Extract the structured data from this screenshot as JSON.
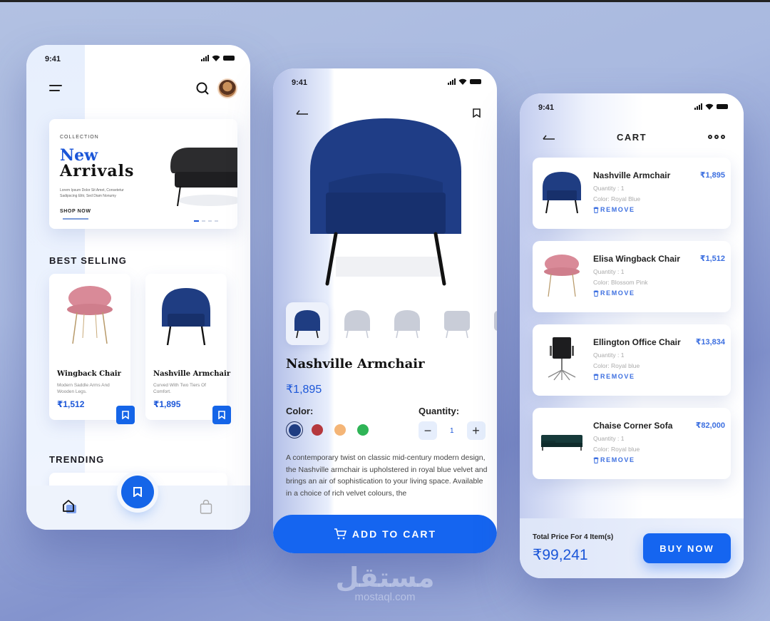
{
  "status_bar": {
    "time": "9:41"
  },
  "home_screen": {
    "banner": {
      "eyebrow": "COLLECTION",
      "title_line1": "New",
      "title_line2": "Arrivals",
      "body": "Lorem Ipsum Dolor Sit Amet, Consetetur Sadipscing Elitr, Sed Diam Nonumy",
      "cta": "SHOP NOW",
      "slide_count": 4,
      "active_slide": 1
    },
    "best_selling_heading": "BEST SELLING",
    "best_selling": [
      {
        "name": "Wingback Chair",
        "desc": "Modern Saddle Arms And Wooden Legs.",
        "price": "₹1,512",
        "color": "#d98a98"
      },
      {
        "name": "Nashville Armchair",
        "desc": "Curved With Two Tiers Of Comfort.",
        "price": "₹1,895",
        "color": "#1f3d82"
      }
    ],
    "trending_heading": "TRENDING",
    "tabbar": {
      "items": [
        "home-icon",
        "bookmark-icon",
        "shopping-bag-icon"
      ],
      "active": "home-icon"
    }
  },
  "product_screen": {
    "name": "Nashville Armchair",
    "price": "₹1,895",
    "color_label": "Color:",
    "colors": [
      {
        "name": "Royal Blue",
        "hex": "#1f3d82",
        "selected": true
      },
      {
        "name": "Red",
        "hex": "#b5383d",
        "selected": false
      },
      {
        "name": "Peach",
        "hex": "#f4b577",
        "selected": false
      },
      {
        "name": "Green",
        "hex": "#2fb456",
        "selected": false
      }
    ],
    "quantity_label": "Quantity:",
    "quantity": "1",
    "minus": "−",
    "plus": "+",
    "description": "A contemporary twist on classic mid-century modern design, the Nashville armchair is upholstered in royal blue velvet and brings an air of sophistication to your living space. Available in a choice of rich velvet colours, the",
    "add_to_cart": "ADD TO CART",
    "thumbnails": 5
  },
  "cart_screen": {
    "title": "CART",
    "items": [
      {
        "name": "Nashville Armchair",
        "quantity": "Quantity : 1",
        "color": "Color: Royal Blue",
        "price": "₹1,895",
        "remove": "REMOVE"
      },
      {
        "name": "Elisa Wingback Chair",
        "quantity": "Quantity : 1",
        "color": "Color: Blossom Pink",
        "price": "₹1,512",
        "remove": "REMOVE"
      },
      {
        "name": "Ellington Office Chair",
        "quantity": "Quantity : 1",
        "color": "Color: Royal blue",
        "price": "₹13,834",
        "remove": "REMOVE"
      },
      {
        "name": "Chaise Corner Sofa",
        "quantity": "Quantity : 1",
        "color": "Color: Royal blue",
        "price": "₹82,000",
        "remove": "REMOVE"
      }
    ],
    "total_label": "Total Price For 4 Item(s)",
    "total": "₹99,241",
    "buy_now": "BUY NOW"
  },
  "watermark": {
    "arabic": "مستقل",
    "latin": "mostaql.com"
  },
  "colors": {
    "accent": "#1565f0",
    "price_blue": "#1b56d8",
    "background": "#a9b9e0"
  }
}
